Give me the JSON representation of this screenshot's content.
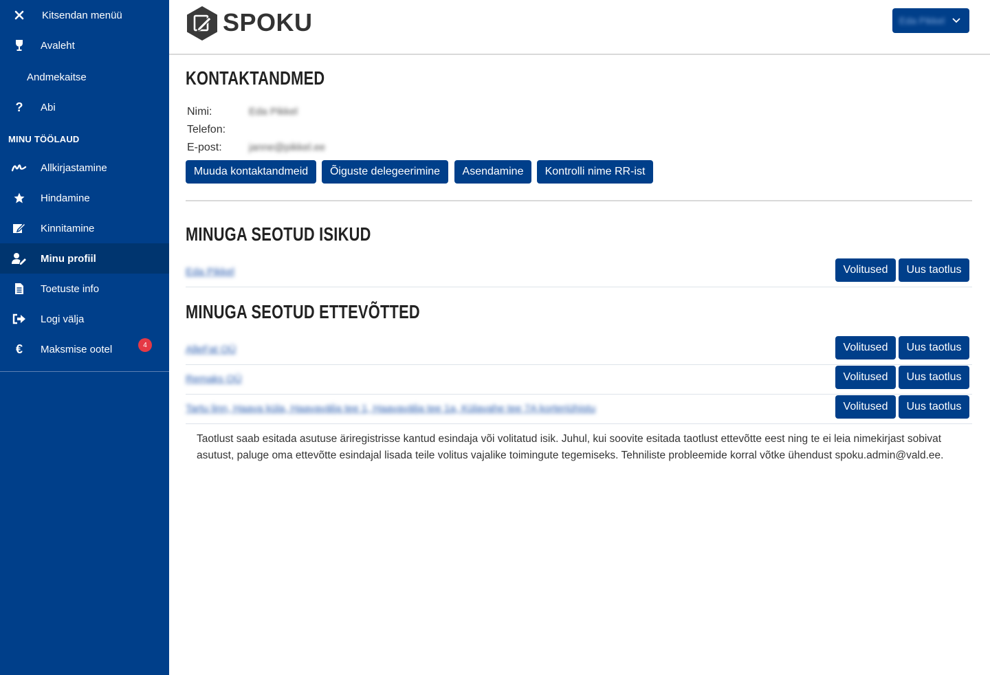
{
  "sidebar": {
    "items": [
      {
        "label": "Kitsendan menüü",
        "icon": "close-icon"
      },
      {
        "label": "Avaleht",
        "icon": "trophy-icon"
      },
      {
        "label": "Andmekaitse",
        "icon": ""
      },
      {
        "label": "Abi",
        "icon": "question-icon"
      }
    ],
    "section_title": "MINU TÖÖLAUD",
    "work_items": [
      {
        "label": "Allkirjastamine",
        "icon": "signature-icon"
      },
      {
        "label": "Hindamine",
        "icon": "star-icon"
      },
      {
        "label": "Kinnitamine",
        "icon": "edit-icon"
      },
      {
        "label": "Minu profiil",
        "icon": "user-edit-icon",
        "active": true
      },
      {
        "label": "Toetuste info",
        "icon": "document-icon"
      },
      {
        "label": "Logi välja",
        "icon": "logout-icon"
      },
      {
        "label": "Maksmise ootel",
        "icon": "euro-icon",
        "badge": "4"
      }
    ]
  },
  "header": {
    "logo_text": "SPOKU",
    "user_name": "Eda Pikkel"
  },
  "contact": {
    "title": "KONTAKTANDMED",
    "name_label": "Nimi:",
    "name_value": "Eda Pikkel",
    "phone_label": "Telefon:",
    "email_label": "E-post:",
    "email_value": "janne@pikkel.ee",
    "buttons": [
      "Muuda kontaktandmeid",
      "Õiguste delegeerimine",
      "Asendamine",
      "Kontrolli nime RR-ist"
    ]
  },
  "persons": {
    "title": "MINUGA SEOTUD ISIKUD",
    "rows": [
      {
        "name": "Eda Pikkel",
        "btn1": "Volitused",
        "btn2": "Uus taotlus"
      }
    ]
  },
  "companies": {
    "title": "MINUGA SEOTUD ETTEVÕTTED",
    "rows": [
      {
        "name": "AlleFat OÜ",
        "btn1": "Volitused",
        "btn2": "Uus taotlus"
      },
      {
        "name": "Remaks OÜ",
        "btn1": "Volitused",
        "btn2": "Uus taotlus"
      },
      {
        "name": "Tartu linn, Haava küla, Haavavälja tee 1, Haavavälja tee 1a, Külavahe tee 7A korteriühistu",
        "btn1": "Volitused",
        "btn2": "Uus taotlus"
      }
    ]
  },
  "note": "Taotlust saab esitada asutuse äriregistrisse kantud esindaja või volitatud isik. Juhul, kui soovite esitada taotlust ettevõtte eest ning te ei leia nimekirjast sobivat asutust, paluge oma ettevõtte esindajal lisada teile volitus vajalike toimingute tegemiseks. Tehniliste probleemide korral võtke ühendust spoku.admin@vald.ee.",
  "colors": {
    "primary": "#003f8a",
    "active": "#00356f",
    "badge": "#e53945"
  }
}
